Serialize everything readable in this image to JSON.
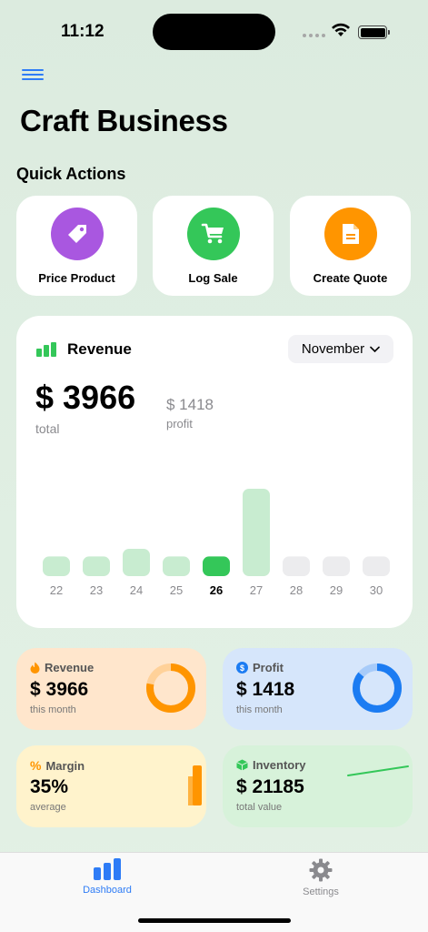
{
  "status_bar": {
    "time": "11:12"
  },
  "page": {
    "title": "Craft Business"
  },
  "quick_actions": {
    "title": "Quick Actions",
    "items": [
      {
        "label": "Price Product",
        "icon": "tag-icon",
        "color": "#a957e0"
      },
      {
        "label": "Log Sale",
        "icon": "cart-icon",
        "color": "#34c759"
      },
      {
        "label": "Create Quote",
        "icon": "document-icon",
        "color": "#ff9500"
      }
    ]
  },
  "revenue_card": {
    "title": "Revenue",
    "month": "November",
    "total": "$ 3966",
    "total_label": "total",
    "profit": "$ 1418",
    "profit_label": "profit"
  },
  "chart_data": {
    "type": "bar",
    "categories": [
      "22",
      "23",
      "24",
      "25",
      "26",
      "27",
      "28",
      "29",
      "30"
    ],
    "values": [
      18,
      18,
      25,
      18,
      18,
      80,
      18,
      18,
      18
    ],
    "selected": "26",
    "ylim": [
      0,
      90
    ],
    "colors": {
      "normal": "#c8ecd0",
      "selected": "#34c759",
      "future": "#ececee"
    },
    "future_from_index": 6
  },
  "stats": [
    {
      "title": "Revenue",
      "value": "$ 3966",
      "sub": "this month",
      "icon": "flame-icon",
      "accent": "#ff9500",
      "ring_fraction": 0.78
    },
    {
      "title": "Profit",
      "value": "$ 1418",
      "sub": "this month",
      "icon": "dollar-icon",
      "accent": "#1c7cf2",
      "ring_fraction": 0.86
    },
    {
      "title": "Margin",
      "value": "35%",
      "sub": "average",
      "icon": "percent-icon",
      "accent": "#ff9500"
    },
    {
      "title": "Inventory",
      "value": "$ 21185",
      "sub": "total value",
      "icon": "box-icon",
      "accent": "#34c759"
    }
  ],
  "tab_bar": {
    "items": [
      {
        "label": "Dashboard",
        "icon": "chart-bar-icon",
        "active": true
      },
      {
        "label": "Settings",
        "icon": "gear-icon",
        "active": false
      }
    ]
  }
}
